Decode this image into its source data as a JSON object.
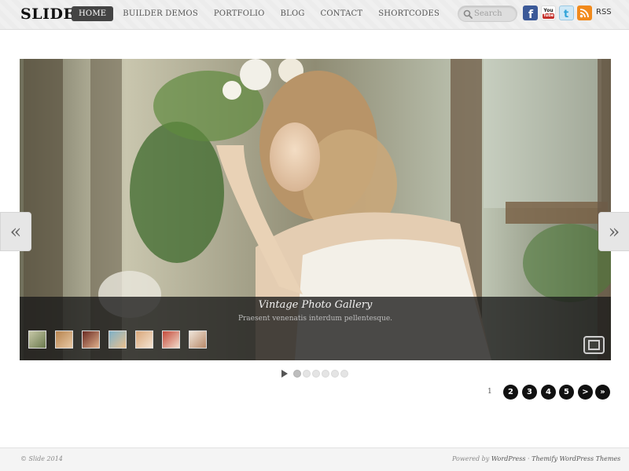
{
  "site": {
    "logo": "SLIDE"
  },
  "nav": {
    "items": [
      {
        "label": "HOME",
        "active": true
      },
      {
        "label": "BUILDER DEMOS",
        "active": false
      },
      {
        "label": "PORTFOLIO",
        "active": false
      },
      {
        "label": "BLOG",
        "active": false
      },
      {
        "label": "CONTACT",
        "active": false
      },
      {
        "label": "SHORTCODES",
        "active": false
      }
    ]
  },
  "search": {
    "placeholder": "Search",
    "icon": "search-icon"
  },
  "social": {
    "facebook_icon": "facebook-icon",
    "youtube_icon": "youtube-icon",
    "youtube_top": "You",
    "youtube_bottom": "Tube",
    "twitter_icon": "twitter-icon",
    "rss_icon": "rss-icon",
    "rss_label": "RSS"
  },
  "slider": {
    "caption_title": "Vintage Photo Gallery",
    "caption_subtitle": "Praesent venenatis interdum pellentesque.",
    "prev_glyph": "«",
    "next_glyph": "»",
    "thumbnail_count": 7,
    "dot_count": 6,
    "active_dot": 1
  },
  "pagination": {
    "current": "1",
    "pages": [
      "2",
      "3",
      "4",
      "5"
    ],
    "next": ">",
    "last": "»"
  },
  "footer": {
    "copyright": "© Slide 2014",
    "powered_prefix": "Powered by ",
    "wordpress": "WordPress",
    "separator": " · ",
    "themify": "Themify WordPress Themes"
  },
  "colors": {
    "nav_active_bg": "#444444",
    "facebook": "#3b5998",
    "rss": "#f18a1c",
    "pager_bg": "#111111"
  }
}
